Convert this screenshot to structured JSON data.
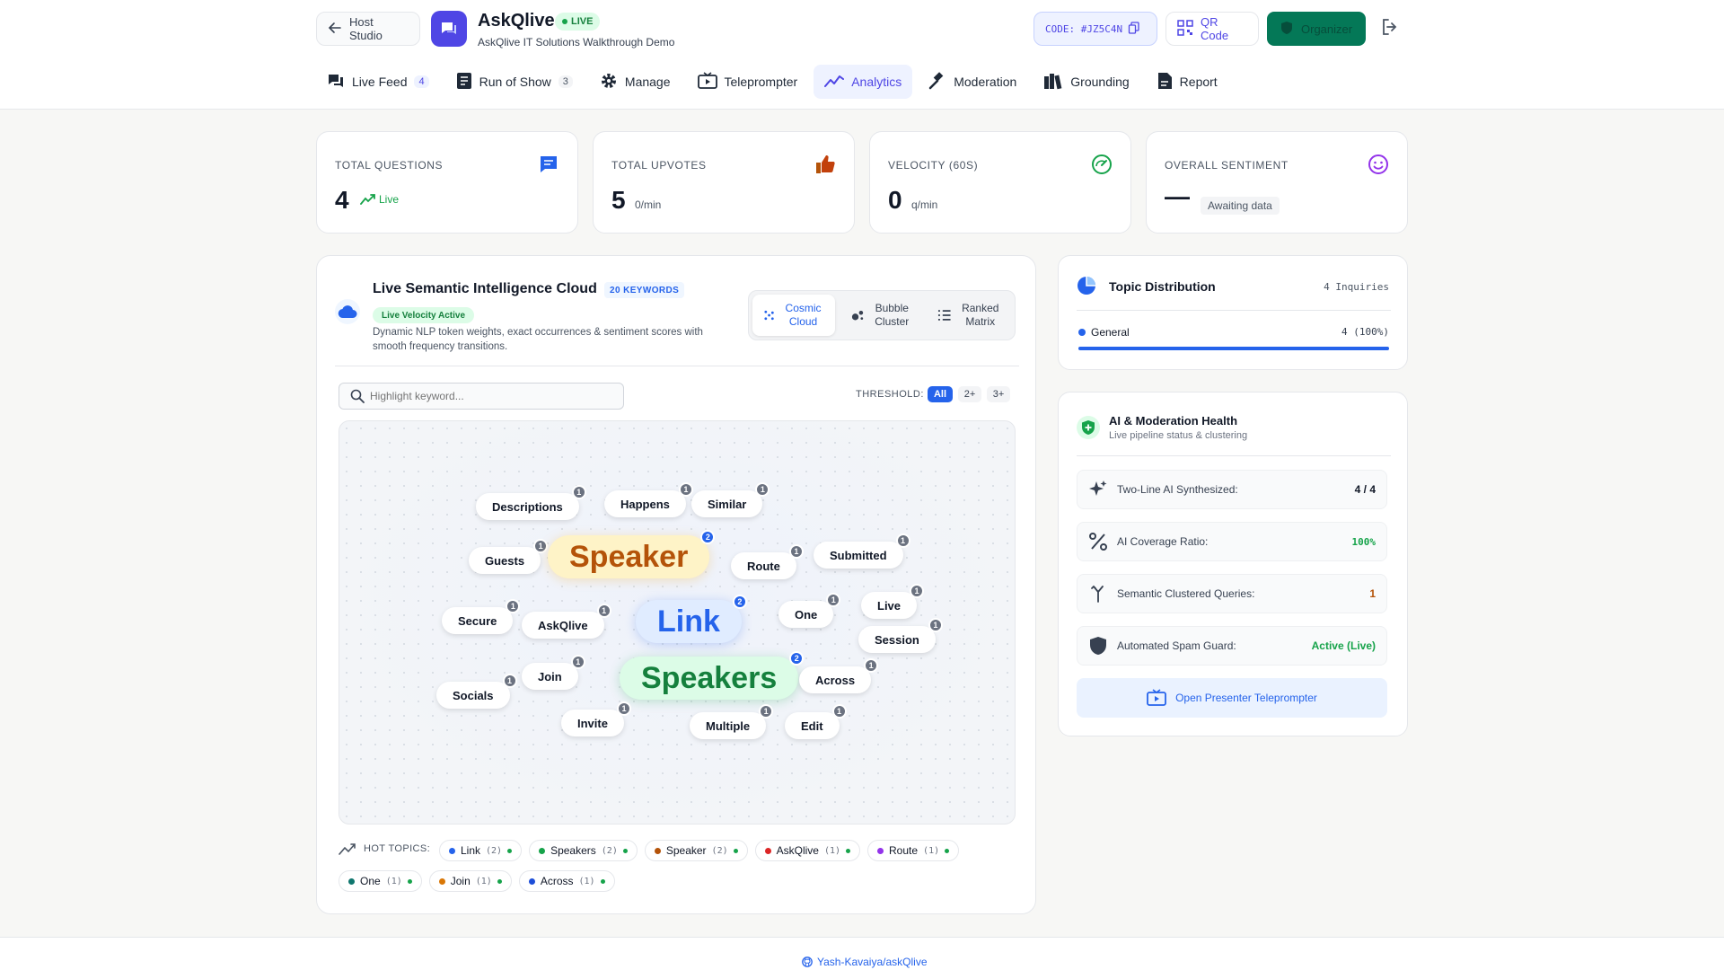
{
  "header": {
    "back_label": "Host Studio",
    "app_title": "AskQlive",
    "live_label": "LIVE",
    "subtitle": "AskQlive IT Solutions Walkthrough Demo",
    "code_label": "CODE: #JZ5C4N",
    "qr_label": "QR Code",
    "organizer_label": "Organizer"
  },
  "tabs": [
    {
      "label": "Live Feed",
      "count": "4"
    },
    {
      "label": "Run of Show",
      "count": "3"
    },
    {
      "label": "Manage"
    },
    {
      "label": "Teleprompter"
    },
    {
      "label": "Analytics"
    },
    {
      "label": "Moderation"
    },
    {
      "label": "Grounding"
    },
    {
      "label": "Report"
    }
  ],
  "stats": [
    {
      "label": "TOTAL QUESTIONS",
      "value": "4",
      "unit": "Live"
    },
    {
      "label": "TOTAL UPVOTES",
      "value": "5",
      "unit": "0/min"
    },
    {
      "label": "VELOCITY (60S)",
      "value": "0",
      "unit": "q/min"
    },
    {
      "label": "OVERALL SENTIMENT",
      "value": "—",
      "unit": "Awaiting data"
    }
  ],
  "cloud": {
    "title": "Live Semantic Intelligence Cloud",
    "keywords_badge": "20 KEYWORDS",
    "velocity_badge": "Live Velocity Active",
    "description": "Dynamic NLP token weights, exact occurrences & sentiment scores with smooth frequency transitions.",
    "views": [
      {
        "label": "Cosmic Cloud"
      },
      {
        "label": "Bubble Cluster"
      },
      {
        "label": "Ranked Matrix"
      }
    ],
    "search_placeholder": "Highlight keyword...",
    "threshold_label": "THRESHOLD:",
    "thresholds": [
      "All",
      "2+",
      "3+"
    ],
    "hot_topics_label": "HOT TOPICS:"
  },
  "keywords": [
    {
      "word": "Descriptions",
      "count": "1"
    },
    {
      "word": "Happens",
      "count": "1"
    },
    {
      "word": "Similar",
      "count": "1"
    },
    {
      "word": "Guests",
      "count": "1"
    },
    {
      "word": "Speaker",
      "count": "2"
    },
    {
      "word": "Route",
      "count": "1"
    },
    {
      "word": "Submitted",
      "count": "1"
    },
    {
      "word": "Secure",
      "count": "1"
    },
    {
      "word": "AskQlive",
      "count": "1"
    },
    {
      "word": "Link",
      "count": "2"
    },
    {
      "word": "One",
      "count": "1"
    },
    {
      "word": "Live",
      "count": "1"
    },
    {
      "word": "Session",
      "count": "1"
    },
    {
      "word": "Socials",
      "count": "1"
    },
    {
      "word": "Join",
      "count": "1"
    },
    {
      "word": "Speakers",
      "count": "2"
    },
    {
      "word": "Across",
      "count": "1"
    },
    {
      "word": "Invite",
      "count": "1"
    },
    {
      "word": "Multiple",
      "count": "1"
    },
    {
      "word": "Edit",
      "count": "1"
    }
  ],
  "hot_topics": [
    {
      "word": "Link",
      "count": "(2)",
      "color": "#2563eb"
    },
    {
      "word": "Speakers",
      "count": "(2)",
      "color": "#16a34a"
    },
    {
      "word": "Speaker",
      "count": "(2)",
      "color": "#b45309"
    },
    {
      "word": "AskQlive",
      "count": "(1)",
      "color": "#dc2626"
    },
    {
      "word": "Route",
      "count": "(1)",
      "color": "#9333ea"
    },
    {
      "word": "One",
      "count": "(1)",
      "color": "#0f766e"
    },
    {
      "word": "Join",
      "count": "(1)",
      "color": "#d97706"
    },
    {
      "word": "Across",
      "count": "(1)",
      "color": "#1d4ed8"
    }
  ],
  "topic_distribution": {
    "title": "Topic Distribution",
    "count_label": "4 Inquiries",
    "items": [
      {
        "label": "General",
        "value": "4 (100%)",
        "share": 1.0
      }
    ]
  },
  "health": {
    "title": "AI & Moderation Health",
    "subtitle": "Live pipeline status & clustering",
    "rows": [
      {
        "label": "Two-Line AI Synthesized:",
        "value": "4 / 4"
      },
      {
        "label": "AI Coverage Ratio:",
        "value": "100%"
      },
      {
        "label": "Semantic Clustered Queries:",
        "value": "1"
      },
      {
        "label": "Automated Spam Guard:",
        "value": "Active (Live)"
      }
    ],
    "teleprompter_label": "Open Presenter Teleprompter"
  },
  "footer": {
    "link_label": "Yash-Kavaiya/askQlive"
  }
}
